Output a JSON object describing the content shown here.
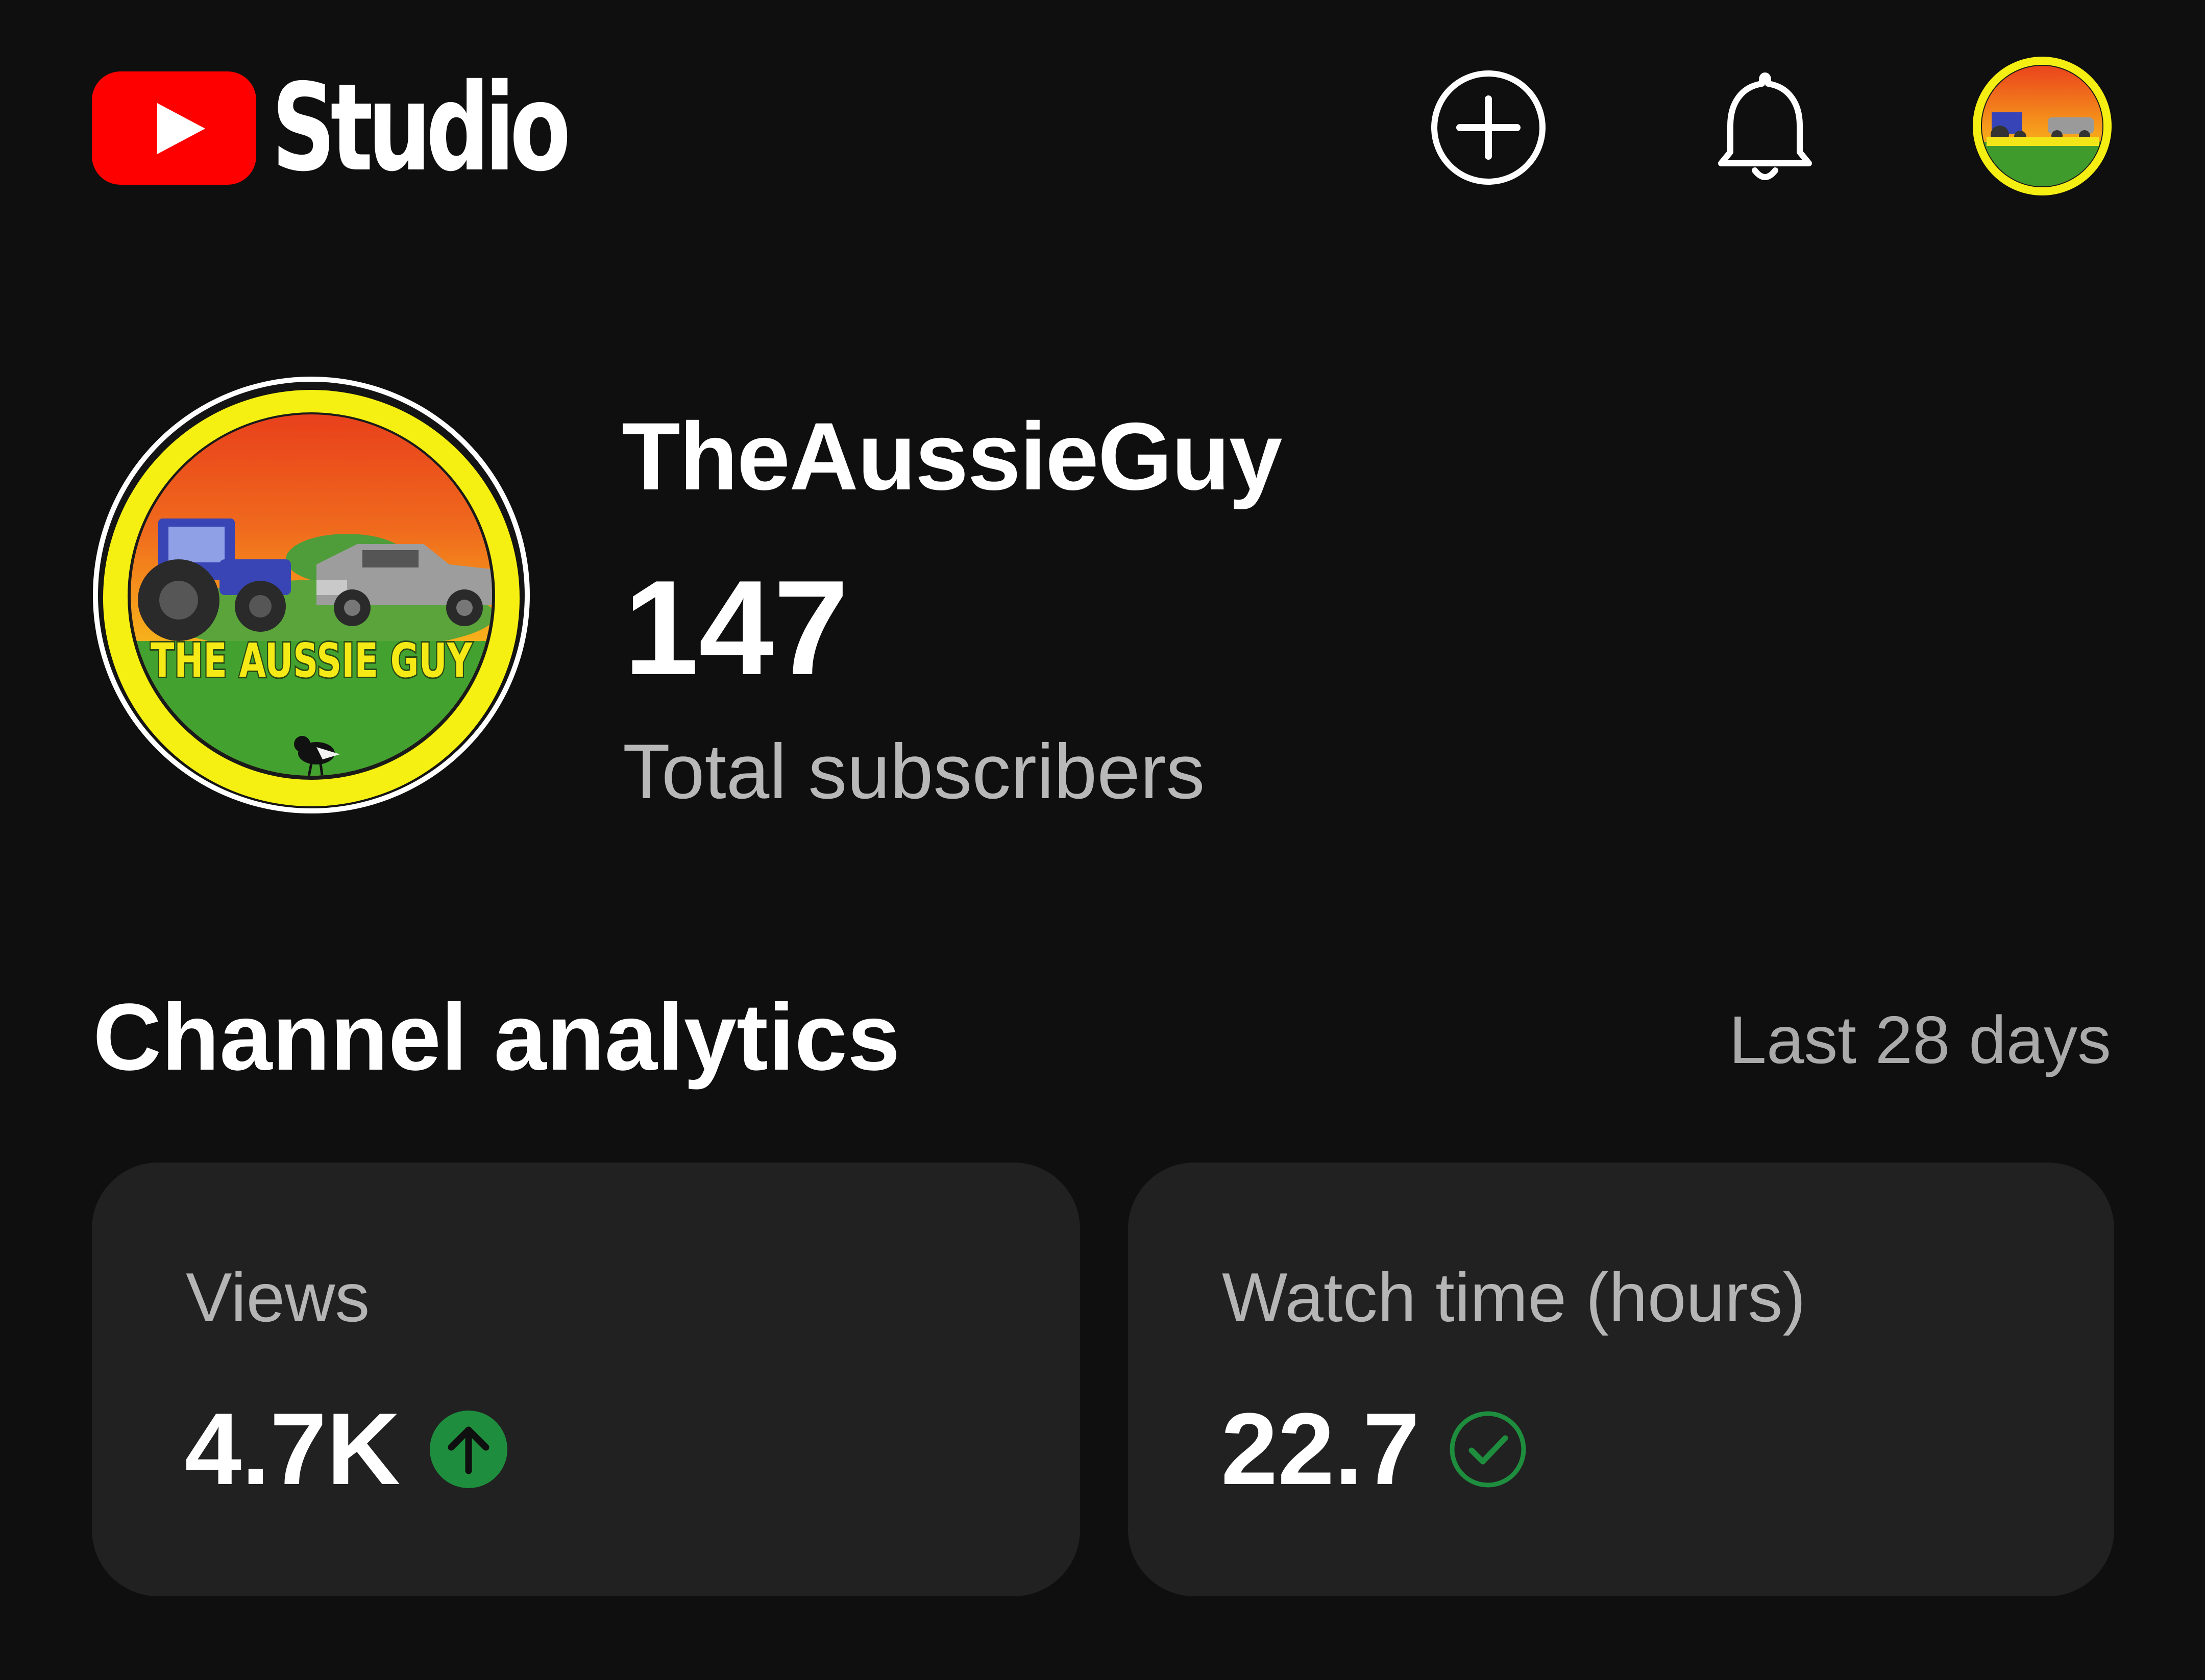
{
  "header": {
    "app_name": "Studio",
    "create_icon": "add-circle-icon",
    "notifications_icon": "bell-icon",
    "account_icon": "account-avatar"
  },
  "channel": {
    "name": "TheAussieGuy",
    "subscriber_count": "147",
    "subscriber_label": "Total subscribers",
    "avatar_text": "THE AUSSIE GUY"
  },
  "analytics": {
    "title": "Channel analytics",
    "range": "Last 28 days",
    "cards": [
      {
        "label": "Views",
        "value": "4.7K",
        "icon": "arrow-up-circle-icon",
        "icon_color": "#1e8e3e"
      },
      {
        "label": "Watch time (hours)",
        "value": "22.7",
        "icon": "check-circle-icon",
        "icon_color": "#1e8e3e"
      }
    ]
  },
  "colors": {
    "background": "#0f0f0f",
    "card": "#212121",
    "brand_red": "#ff0000",
    "positive_green": "#1e8e3e"
  }
}
